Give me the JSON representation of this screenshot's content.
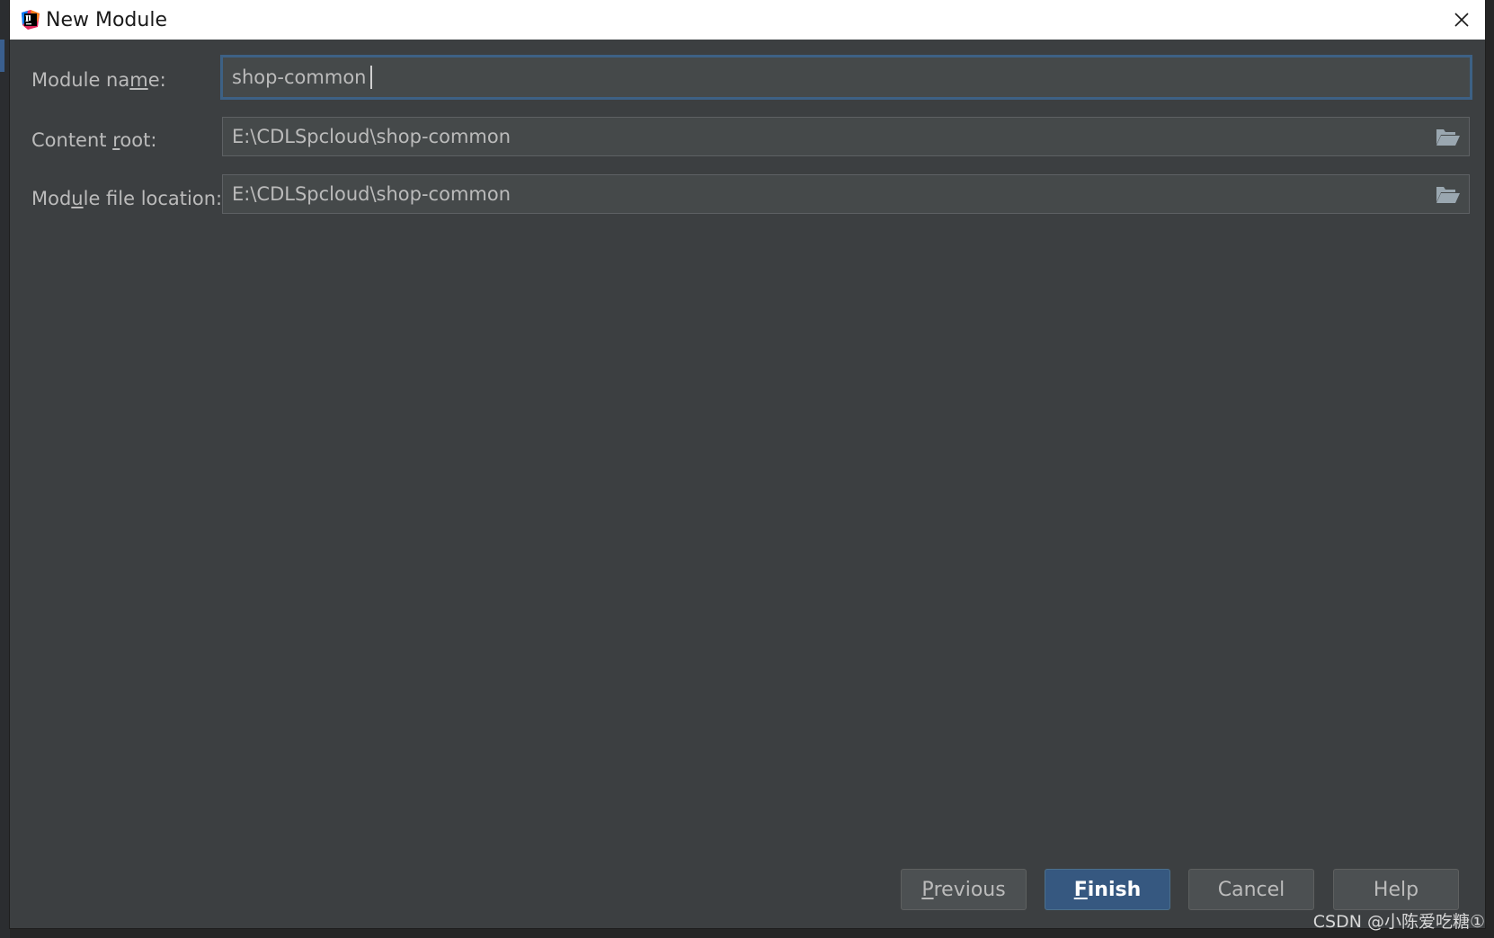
{
  "window": {
    "title": "New Module",
    "app_icon": "intellij-idea-icon",
    "close_icon": "close-icon"
  },
  "form": {
    "module_name": {
      "label_pre": "Module na",
      "label_mnemonic": "m",
      "label_post": "e:",
      "value": "shop-common"
    },
    "content_root": {
      "label_pre": "Content ",
      "label_mnemonic": "r",
      "label_post": "oot:",
      "value": "E:\\CDLSpcloud\\shop-common",
      "browse_icon": "folder-open-icon"
    },
    "module_file_location": {
      "label_pre": "Mod",
      "label_mnemonic": "u",
      "label_post": "le file location:",
      "value": "E:\\CDLSpcloud\\shop-common",
      "browse_icon": "folder-open-icon"
    }
  },
  "buttons": {
    "previous": {
      "mnemonic": "P",
      "rest": "revious"
    },
    "finish": {
      "mnemonic": "F",
      "rest": "inish"
    },
    "cancel": {
      "label": "Cancel"
    },
    "help": {
      "label": "Help"
    }
  },
  "watermark": "CSDN @小陈爱吃糖①",
  "colors": {
    "dialog_background": "#3c3f41",
    "field_background": "#45494a",
    "focus_border": "#3d6185",
    "primary_button": "#365880",
    "text": "#bbbbbb"
  }
}
